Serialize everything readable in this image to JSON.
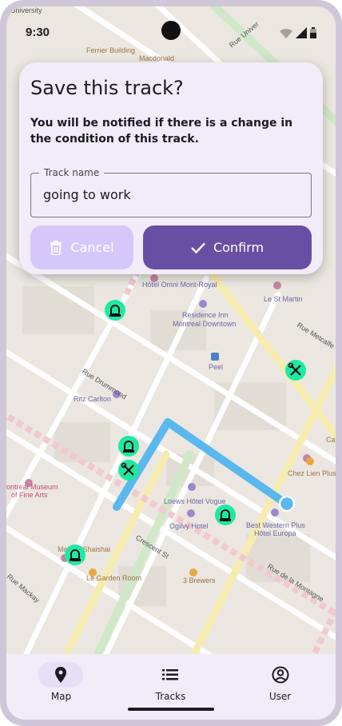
{
  "status_bar": {
    "time": "9:30"
  },
  "map": {
    "labels": {
      "university": "it University",
      "ferrier": "Ferrier Building",
      "macdonald": "Macdonald",
      "rue_university": "Rue Univer",
      "omni": "Hôtel Omni Mont-Royal",
      "residence_inn_1": "Residence Inn",
      "residence_inn_2": "Montreal Downtown",
      "le_st_martin": "Le St Martin",
      "rue_metcalfe": "Rue Metcalfe",
      "peel": "Peel",
      "rue_drummond": "Rue Drummond",
      "ritz": "Ritz Carlton",
      "museum_1": "ontreal Museum",
      "museum_2": "of Fine Arts",
      "loews": "Loews Hôtel Vogue",
      "ogilvy": "Ogilvy Hotel",
      "best_western_1": "Best Western Plus",
      "best_western_2": "Hôtel Europa",
      "chez_lien": "Chez Lien Plus",
      "crescent": "Crescent St",
      "shaishai": "Maison Shaishai",
      "garden_room": "Le Garden Room",
      "three_brewers": "3 Brewers",
      "rue_montagne": "Rue de la Montagne",
      "rue_mackay": "Rue Mackay",
      "cal": "Cal",
      "left_rue": "Rue"
    }
  },
  "dialog": {
    "title": "Save this track?",
    "message": "You will be notified if there is a change in the condition of this track.",
    "field_label": "Track name",
    "field_value": "going to work",
    "cancel_label": "Cancel",
    "confirm_label": "Confirm"
  },
  "nav": {
    "items": [
      {
        "label": "Map",
        "icon": "location-pin-icon"
      },
      {
        "label": "Tracks",
        "icon": "list-icon"
      },
      {
        "label": "User",
        "icon": "account-circle-icon"
      }
    ]
  },
  "colors": {
    "primary": "#6750a4",
    "primary_disabled": "#d6c7fb",
    "track_line": "#5ab8ee",
    "marker": "#1de9a3"
  }
}
